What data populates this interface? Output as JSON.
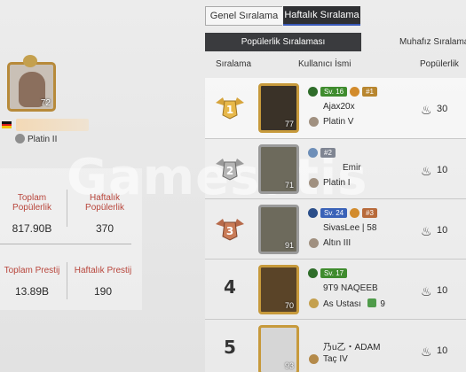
{
  "watermark": "Gamesatis",
  "profile": {
    "level": "72",
    "tier": "Platin II",
    "flag_colors": [
      "#111111",
      "#dd1b1b",
      "#f2c200"
    ]
  },
  "stats": {
    "total_pop_label": "Toplam Popülerlik",
    "total_pop_value": "817.90B",
    "weekly_pop_label": "Haftalık Popülerlik",
    "weekly_pop_value": "370",
    "total_pres_label": "Toplam Prestij",
    "total_pres_value": "13.89B",
    "weekly_pres_label": "Haftalık Prestij",
    "weekly_pres_value": "190"
  },
  "tabs": {
    "general": "Genel Sıralama",
    "weekly": "Haftalık Sıralama"
  },
  "subtabs": {
    "popularity": "Popülerlik Sıralaması",
    "guardian": "Muhafız Sıralama"
  },
  "headers": {
    "rank": "Sıralama",
    "user": "Kullanıcı İsmi",
    "popularity": "Popülerlik"
  },
  "rows": [
    {
      "rank": "1",
      "level": "77",
      "lvl_badge": "Sv. 16",
      "lvl_color": "#3f8c2e",
      "extra_badge": "#1",
      "name": "Ajax20x",
      "tier": "Platin V",
      "score": "30"
    },
    {
      "rank": "2",
      "level": "71",
      "lvl_badge": "",
      "lvl_color": "",
      "extra_badge": "#2",
      "name": "Emir",
      "tier": "Platin I",
      "score": "10"
    },
    {
      "rank": "3",
      "level": "91",
      "lvl_badge": "Sv. 24",
      "lvl_color": "#3a62b8",
      "extra_badge": "#3",
      "name": "SivasLee | 58",
      "tier": "Altın III",
      "score": "10"
    },
    {
      "rank": "4",
      "level": "70",
      "lvl_badge": "Sv. 17",
      "lvl_color": "#3f8c2e",
      "extra_badge": "",
      "name": "9T9 NAQEEB",
      "tier": "As Ustası",
      "tier_extra": "9",
      "score": "10"
    },
    {
      "rank": "5",
      "level": "93",
      "lvl_badge": "",
      "lvl_color": "",
      "extra_badge": "",
      "name": "乃u乙・ADAM",
      "tier": "Taç IV",
      "score": "10"
    }
  ]
}
